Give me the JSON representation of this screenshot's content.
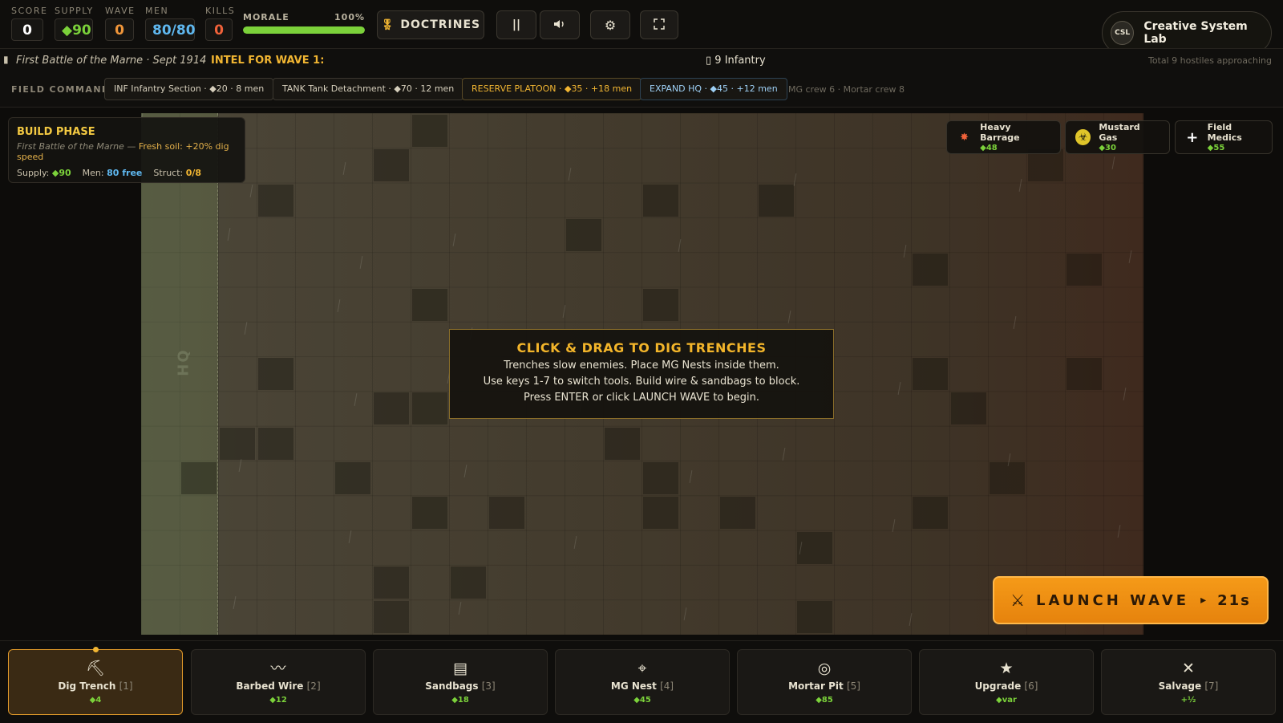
{
  "hud": {
    "score": {
      "label": "SCORE",
      "value": "0"
    },
    "supply": {
      "label": "SUPPLY",
      "value": "◆90"
    },
    "wave": {
      "label": "WAVE",
      "value": "0"
    },
    "men": {
      "label": "MEN",
      "value": "80/80"
    },
    "kills": {
      "label": "KILLS",
      "value": "0"
    },
    "morale": {
      "label": "MORALE",
      "value_text": "100%",
      "fraction": 1.0
    },
    "doctrines_label": "DOCTRINES",
    "pause_icon": "pause-icon",
    "sound_icon": "speaker-icon",
    "settings_icon": "gear-icon",
    "fullscreen_icon": "fullscreen-icon"
  },
  "brand": {
    "logo_text": "CSL",
    "name": "Creative System Lab"
  },
  "intel": {
    "battle": "First Battle of the Marne · Sept 1914",
    "label": "INTEL FOR WAVE 1:",
    "count": "▯ 9 Infantry",
    "total": "Total 9 hostiles approaching"
  },
  "field_command": {
    "label": "FIELD COMMAND",
    "buttons": [
      "INF Infantry Section · ◆20 · 8 men",
      "TANK Tank Detachment · ◆70 · 12 men",
      "RESERVE PLATOON · ◆35 · +18 men",
      "EXPAND HQ · ◆45 · +12 men"
    ],
    "crew": "MG crew 6 · Mortar crew 8"
  },
  "build": {
    "title": "BUILD PHASE",
    "battle": "First Battle of the Marne",
    "separator": " — ",
    "bonus": "Fresh soil: +20% dig speed",
    "supply_label": "Supply:",
    "supply_value": "◆90",
    "men_label": "Men:",
    "men_value": "80 free",
    "struct_label": "Struct:",
    "struct_value": "0/8"
  },
  "abilities": [
    {
      "name": "Heavy Barrage",
      "cost": "◆48",
      "icon": "explosion-icon"
    },
    {
      "name": "Mustard Gas",
      "cost": "◆30",
      "icon": "biohazard-icon"
    },
    {
      "name": "Field Medics",
      "cost": "◆55",
      "icon": "plus-icon"
    }
  ],
  "field": {
    "hq_label": "HQ"
  },
  "instructions": {
    "title": "CLICK & DRAG TO DIG TRENCHES",
    "lines": [
      "Trenches slow enemies. Place MG Nests inside them.",
      "Use keys 1-7 to switch tools. Build wire & sandbags to block.",
      "Press ENTER or click LAUNCH WAVE to begin."
    ]
  },
  "launch": {
    "label": "LAUNCH WAVE",
    "arrow": "▸",
    "timer": "21s",
    "icon": "crossed-swords-icon"
  },
  "tools": [
    {
      "name": "Dig Trench",
      "key": "[1]",
      "cost": "◆4",
      "icon": "pickaxe-icon",
      "active": true
    },
    {
      "name": "Barbed Wire",
      "key": "[2]",
      "cost": "◆12",
      "icon": "wire-icon",
      "active": false
    },
    {
      "name": "Sandbags",
      "key": "[3]",
      "cost": "◆18",
      "icon": "sandbags-icon",
      "active": false
    },
    {
      "name": "MG Nest",
      "key": "[4]",
      "cost": "◆45",
      "icon": "crosshair-icon",
      "active": false
    },
    {
      "name": "Mortar Pit",
      "key": "[5]",
      "cost": "◆85",
      "icon": "target-icon",
      "active": false
    },
    {
      "name": "Upgrade",
      "key": "[6]",
      "cost": "◆var",
      "icon": "star-icon",
      "active": false
    },
    {
      "name": "Salvage",
      "key": "[7]",
      "cost": "+½",
      "icon": "x-icon",
      "active": false
    }
  ],
  "colors": {
    "accent": "#f2b632",
    "supply": "#7bd13a",
    "men": "#5fb8f0",
    "danger": "#f0623a",
    "launch": "#f0911a"
  }
}
